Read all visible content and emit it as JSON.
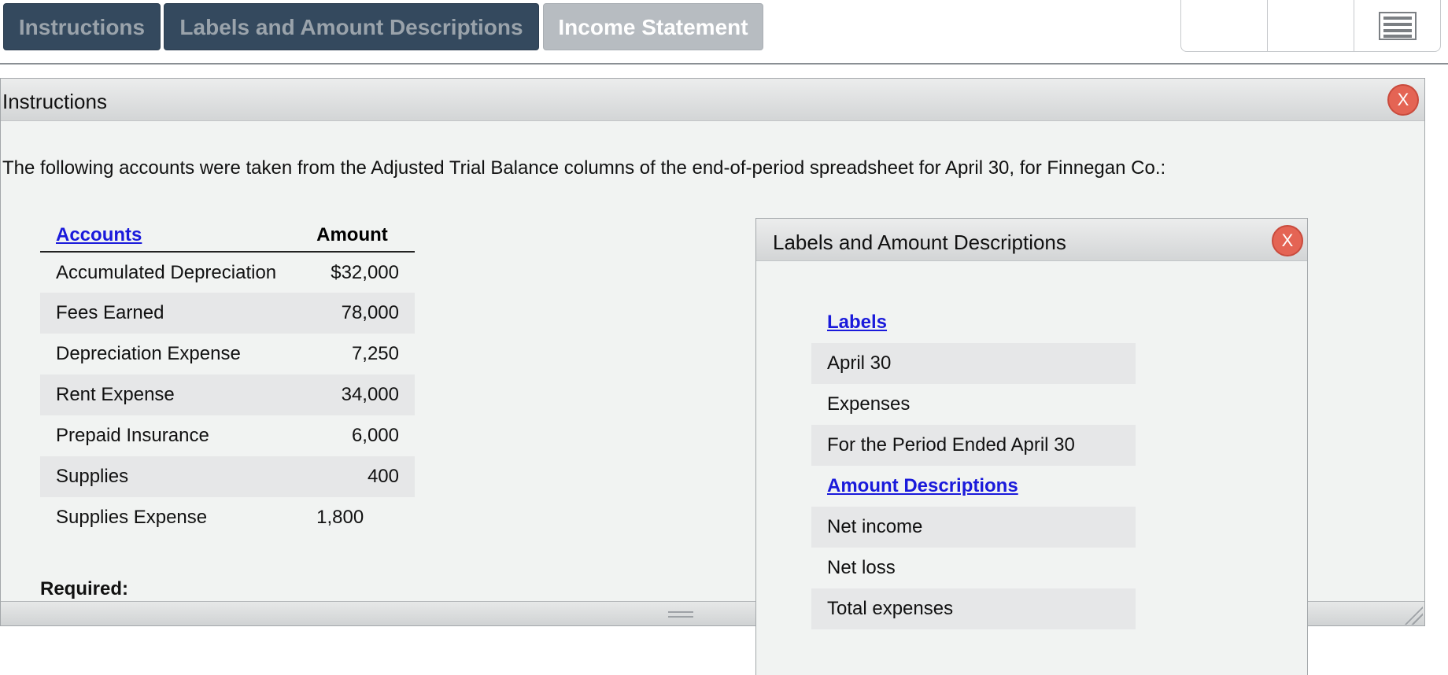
{
  "tabs": {
    "instructions": "Instructions",
    "labels": "Labels and Amount Descriptions",
    "income": "Income Statement"
  },
  "icons": {
    "menu": "menu-icon",
    "close": "close-icon"
  },
  "colors": {
    "tab_dark": "#34495e",
    "tab_light": "#b7bcc1",
    "close": "#e46454",
    "link": "#1a1adb"
  },
  "instructions_panel": {
    "title": "Instructions",
    "close_label": "X",
    "intro": "The following accounts were taken from the Adjusted Trial Balance columns of the end-of-period spreadsheet for April 30, for Finnegan Co.:",
    "table": {
      "header_accounts": "Accounts",
      "header_amount": "Amount",
      "rows": [
        {
          "account": "Accumulated Depreciation",
          "amount": "$32,000"
        },
        {
          "account": "Fees Earned",
          "amount": "78,000"
        },
        {
          "account": "Depreciation Expense",
          "amount": "7,250"
        },
        {
          "account": "Rent Expense",
          "amount": "34,000"
        },
        {
          "account": "Prepaid Insurance",
          "amount": "6,000"
        },
        {
          "account": "Supplies",
          "amount": "400"
        },
        {
          "account": "Supplies Expense",
          "amount": "1,800"
        }
      ]
    },
    "required_label": "Required:"
  },
  "labels_popup": {
    "title": "Labels and Amount Descriptions",
    "close_label": "X",
    "labels_heading": "Labels",
    "labels": [
      "April 30",
      "Expenses",
      "For the Period Ended April 30"
    ],
    "amounts_heading": "Amount Descriptions",
    "amount_descriptions": [
      "Net income",
      "Net loss",
      "Total expenses"
    ]
  }
}
